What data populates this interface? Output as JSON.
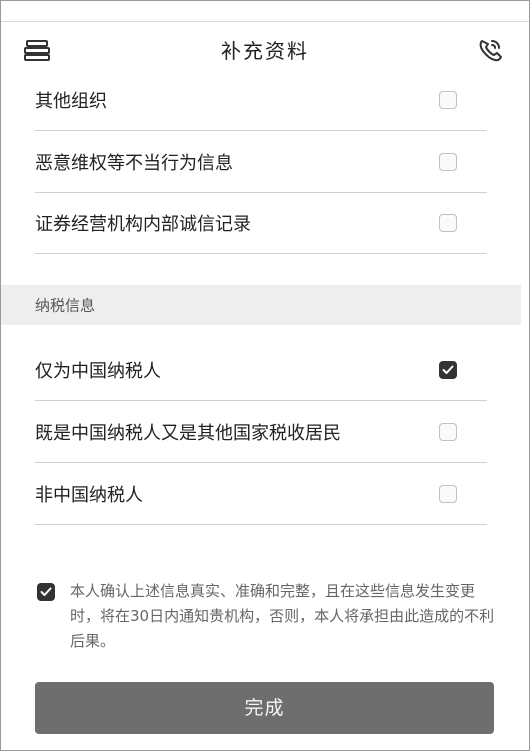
{
  "header": {
    "title": "补充资料",
    "left_icon": "stack-layers-icon",
    "right_icon": "phone-call-icon"
  },
  "record_options": [
    {
      "label": "其他组织",
      "checked": false
    },
    {
      "label": "恶意维权等不当行为信息",
      "checked": false
    },
    {
      "label": "证券经营机构内部诚信记录",
      "checked": false
    }
  ],
  "tax_section": {
    "title": "纳税信息",
    "options": [
      {
        "label": "仅为中国纳税人",
        "checked": true
      },
      {
        "label": "既是中国纳税人又是其他国家税收居民",
        "checked": false
      },
      {
        "label": "非中国纳税人",
        "checked": false
      }
    ]
  },
  "confirmation": {
    "checked": true,
    "text": "本人确认上述信息真实、准确和完整，且在这些信息发生变更时，将在30日内通知贵机构，否则，本人将承担由此造成的不利后果。"
  },
  "done_button": {
    "label": "完成"
  },
  "colors": {
    "button_bg": "#6e6e6e",
    "checkbox_checked": "#333333",
    "section_bg": "#eeeeee",
    "divider": "#cfcfcf"
  }
}
